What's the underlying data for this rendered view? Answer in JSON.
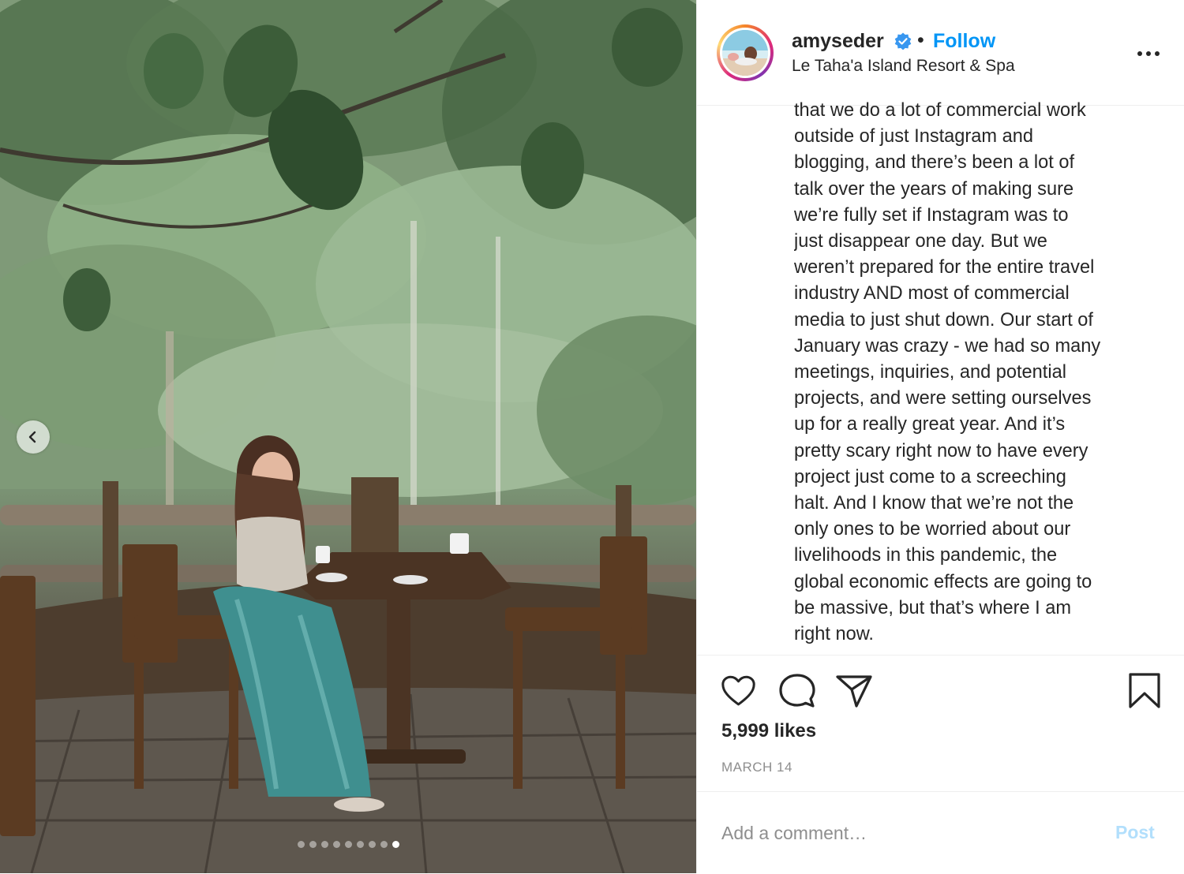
{
  "header": {
    "username": "amyseder",
    "separator": "•",
    "follow_label": "Follow",
    "location": "Le Taha'a Island Resort & Spa",
    "verified_icon": "verified-badge-icon",
    "more_icon": "more-options-icon"
  },
  "media": {
    "prev_icon": "chevron-left-icon",
    "carousel_total": 9,
    "carousel_active_index": 9
  },
  "caption": {
    "lines": [
      "that we do a lot of commercial work",
      "outside of just Instagram and",
      "blogging, and there’s been a lot of",
      "talk over the years of making sure",
      "we’re fully set if Instagram was to",
      "just disappear one day. But we",
      "weren’t prepared for the entire travel",
      "industry AND most of commercial",
      "media to just shut down. Our start of",
      "January was crazy - we had so many",
      "meetings, inquiries, and potential",
      "projects, and were setting ourselves",
      "up for a really great year. And it’s",
      "pretty scary right now to have every",
      "project just come to a screeching",
      "halt. And I know that we’re not the",
      "only ones to be worried about our",
      "livelihoods in this pandemic, the",
      "global economic effects are going to",
      "be massive, but that’s where I am",
      "right now."
    ]
  },
  "actions": {
    "icons": [
      "heart-icon",
      "comment-icon",
      "share-icon",
      "bookmark-icon"
    ],
    "likes": "5,999 likes",
    "date": "MARCH 14"
  },
  "comment": {
    "placeholder": "Add a comment…",
    "post_label": "Post"
  },
  "colors": {
    "link_blue": "#0095f6",
    "post_disabled": "#b2dffc",
    "muted_text": "#8e8e8e",
    "border": "#efefef"
  }
}
